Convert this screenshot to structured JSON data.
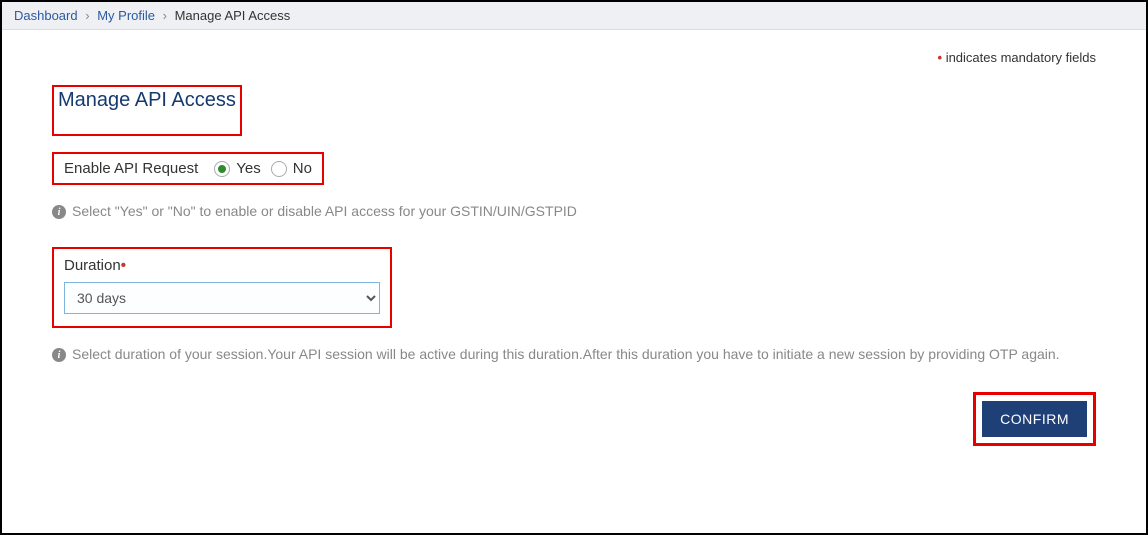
{
  "breadcrumb": {
    "dashboard": "Dashboard",
    "profile": "My Profile",
    "current": "Manage API Access"
  },
  "mandatory_note": "indicates mandatory fields",
  "page_heading": "Manage API Access",
  "enable_api": {
    "label": "Enable API Request",
    "yes": "Yes",
    "no": "No",
    "selected": "yes"
  },
  "info1": "Select \"Yes\" or \"No\" to enable or disable API access for your GSTIN/UIN/GSTPID",
  "duration": {
    "label": "Duration",
    "value": "30 days",
    "options": [
      "30 days"
    ]
  },
  "info2": "Select duration of your session.Your API session will be active during this duration.After this duration you have to initiate a new session by providing OTP again.",
  "confirm_label": "CONFIRM"
}
